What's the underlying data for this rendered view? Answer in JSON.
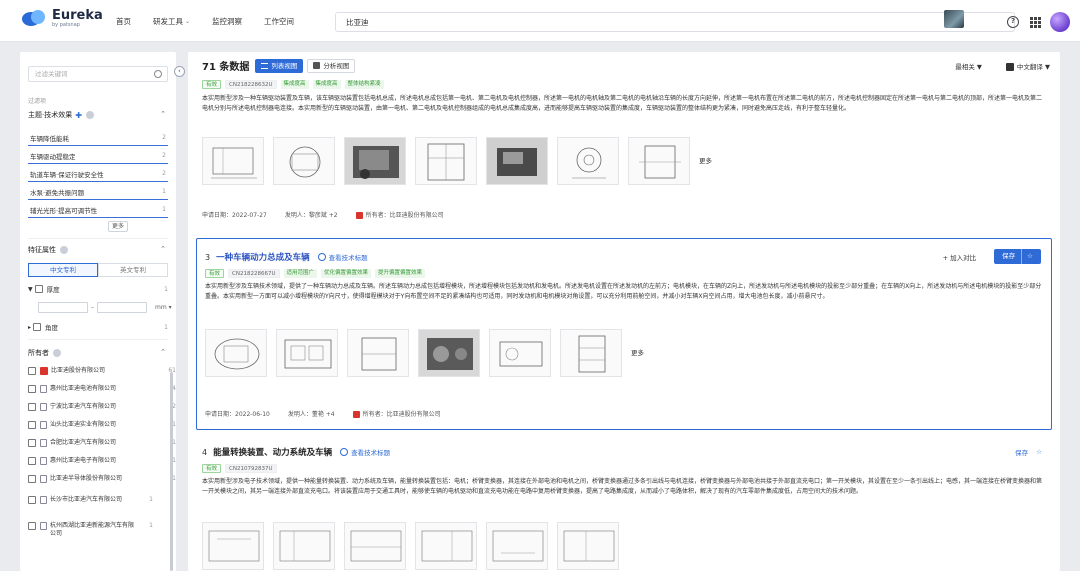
{
  "topbar": {
    "logo_name": "Eureka",
    "logo_sub": "by patsnap",
    "nav": [
      {
        "label": "首页",
        "has_menu": false
      },
      {
        "label": "研发工具",
        "has_menu": true
      },
      {
        "label": "监控洞察",
        "has_menu": false
      },
      {
        "label": "工作空间",
        "has_menu": false
      }
    ],
    "search_value": "比亚迪",
    "icons": [
      "image-search-icon",
      "help-icon",
      "apps-grid-icon",
      "user-avatar"
    ]
  },
  "sidebar": {
    "search_placeholder": "过滤关键词",
    "filter_section_label": "过滤项",
    "tech_effect_title": "主题·技术效果",
    "effects": [
      {
        "label": "车辆降低能耗",
        "count": "2"
      },
      {
        "label": "车辆驱动提稳定",
        "count": "2"
      },
      {
        "label": "轨道车辆·保证行驶安全性",
        "count": "2"
      },
      {
        "label": "水泵·避免共振问题",
        "count": "1"
      },
      {
        "label": "辅光光形·提高可调节性",
        "count": "1"
      }
    ],
    "more_label": "更多",
    "feature_title": "特征属性",
    "lang_tabs": [
      "中文专利",
      "英文专利"
    ],
    "thickness_label": "厚度",
    "thickness_count": "1",
    "thickness_unit": "mm ▾",
    "angle_label": "角度",
    "angle_count": "1",
    "owner_title": "所有者",
    "owners": [
      {
        "name": "比亚迪股份有限公司",
        "count": "61",
        "brand": true
      },
      {
        "name": "惠州比亚迪电池有限公司",
        "count": "4",
        "brand": false
      },
      {
        "name": "宁波比亚迪汽车有限公司",
        "count": "2",
        "brand": false
      },
      {
        "name": "汕头比亚迪实业有限公司",
        "count": "1",
        "brand": false
      },
      {
        "name": "合肥比亚迪汽车有限公司",
        "count": "1",
        "brand": false
      },
      {
        "name": "惠州比亚迪电子有限公司",
        "count": "1",
        "brand": false
      },
      {
        "name": "比亚迪半导体股份有限公司",
        "count": "1",
        "brand": false
      },
      {
        "name": "长沙市比亚迪汽车有限公司",
        "count": "1",
        "brand": false
      },
      {
        "name": "杭州西湖比亚迪新能源汽车有限公司",
        "count": "1",
        "brand": false
      }
    ]
  },
  "main": {
    "count_text": "71 条数据",
    "view_list": "列表视图",
    "view_analysis": "分析视图",
    "sort_label": "最相关 ▼",
    "translate_label": "中文翻译 ▼",
    "cards": [
      {
        "index": "",
        "title": "",
        "tags": [
          "有效",
          "CN218228632U",
          "集成度高",
          "集成度高",
          "整体结构紧凑"
        ],
        "abstract": "本实用新型涉及一种车辆驱动装置及车辆，该车辆驱动装置包括电机总成，所述电机总成包括第一电机、第二电机及电机控制器，所述第一电机的电机轴及第二电机的电机轴沿车辆的长度方向延伸，所述第一电机布置在所述第二电机的前方，所述电机控制器固定在所述第一电机与第二电机的顶部，所述第一电机及第二电机分别与所述电机控制器电连接。本实用新型的车辆驱动装置，由第一电机、第二电机及电机控制器组成的电机总成集成度高，进而能够提高车辆驱动装置的集成度，车辆驱动装置的整体结构更为紧凑，同时避免高压走线，有利于整车轻量化。",
        "more_label": "更多",
        "date": "申请日期：2022-07-27",
        "inventor": "发明人：黎彦斌 +2",
        "owner": "所有者：比亚迪股份有限公司"
      },
      {
        "index": "3",
        "title": "一种车辆动力总成及车辆",
        "tech_label": "查看技术标题",
        "tags": [
          "有效",
          "CN218228667U",
          "适用范围广",
          "优化偏置偏置效果",
          "提升偏置偏置效果"
        ],
        "abstract": "本实用新型涉及车辆技术领域，提供了一种车辆动力总成及车辆。所述车辆动力总成包括增程模块，所述增程模块包括发动机和发电机。所述发电机设置在所述发动机的左前方；电机模块，在车辆的Z向上，所述发动机与所述电机模块的投影至少部分重叠；在车辆的X向上，所述发动机与所述电机模块的投影至少部分重叠。本实用新型一方面可以减小增程模块的Y向尺寸，使得增程模块对于Y向布置空间不足的紧凑结构也可适用，同时发动机和电机模块对角设置，可以充分利用前舱空间，并减小对车辆X向空间占用，增大电池包长度，减小前悬尺寸。",
        "more_label": "更多",
        "date": "申请日期：2022-06-10",
        "inventor": "发明人：董艳 +4",
        "owner": "所有者：比亚迪股份有限公司",
        "compare_label": "+ 加入对比",
        "save_label": "保存"
      },
      {
        "index": "4",
        "title": "能量转换装置、动力系统及车辆",
        "tech_label": "查看技术标题",
        "tags": [
          "有效",
          "CN210792837U"
        ],
        "abstract": "本实用新型涉及电子技术领域，提供一种能量转换装置、动力系统及车辆，能量转换装置包括：电机；桥臂变换器，其连接在外部电池和电机之间，桥臂变换器通过多条引出线与电机连接，桥臂变换器与外部电池共接于外部直流充电口；第一开关模块，其设置在至少一条引出线上；电感，其一端连接在桥臂变换器和第一开关模块之间，其另一端连接外部直流充电口。将该装置应用于交通工具时，能够使车辆的电机驱动和直流充电功能在电路中复用桥臂变换器，提高了电路集成度，从而减小了电路体积，解决了现有的汽车零部件集成度低，占用空间大的技术问题。",
        "save_label": "保存"
      }
    ]
  },
  "colors": {
    "accent": "#2f6bd6",
    "valid_green": "#3b9b3b",
    "brand_red": "#d9352c"
  }
}
